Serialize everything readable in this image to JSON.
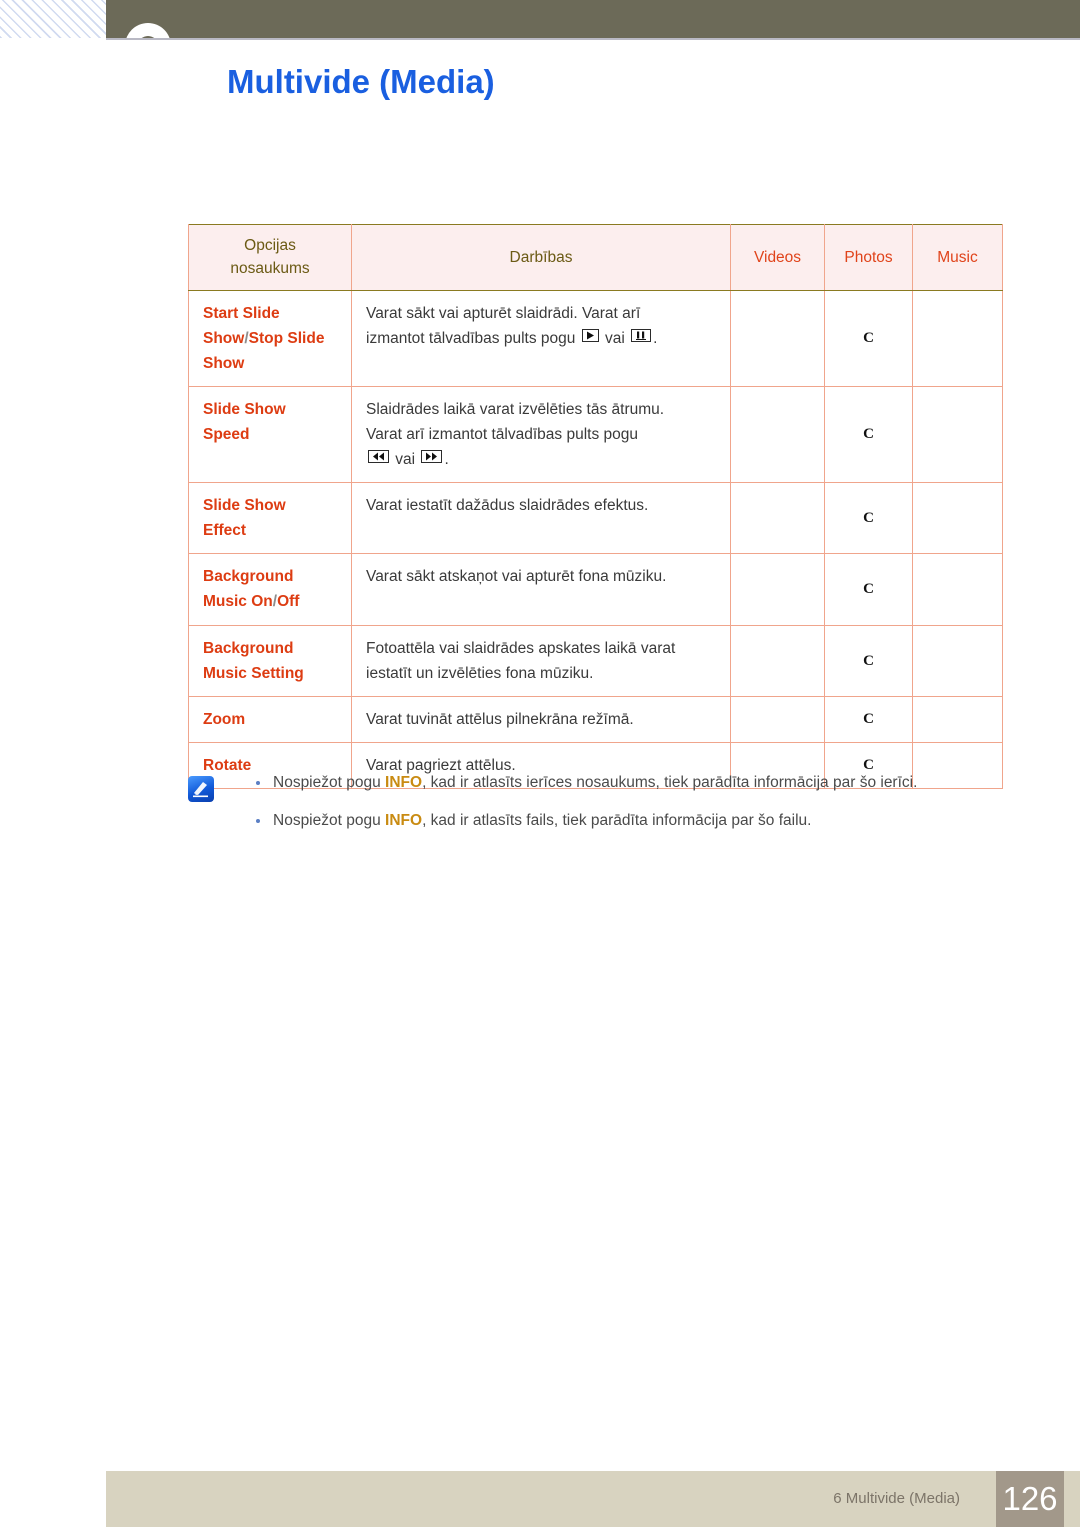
{
  "header": {
    "title": "Multivide (Media)",
    "chapter_badge": "chapter-circle"
  },
  "table": {
    "columns": [
      {
        "label": "Opcijas\nnosaukums",
        "line1": "Opcijas",
        "line2": "nosaukums",
        "style": "olive"
      },
      {
        "label": "Darbības",
        "style": "olive"
      },
      {
        "label": "Videos",
        "style": "red"
      },
      {
        "label": "Photos",
        "style": "red"
      },
      {
        "label": "Music",
        "style": "red"
      }
    ],
    "rows": [
      {
        "name_parts": [
          "Start Slide Show",
          "/",
          "Stop Slide Show"
        ],
        "name_plain": "Start Slide Show/Stop Slide Show",
        "desc_line1": "Varat sākt vai apturēt slaidrādi. Varat arī",
        "desc_line2_pre": "izmantot tālvadības pults pogu ",
        "desc_mid": " vai ",
        "desc_end": ".",
        "keys": [
          "play-icon",
          "pause-icon"
        ],
        "videos": "",
        "photos": "C",
        "music": ""
      },
      {
        "name_parts": [
          "Slide Show Speed"
        ],
        "name_plain": "Slide Show Speed",
        "desc_line1": "Slaidrādes laikā varat izvēlēties tās ātrumu.",
        "desc_line2_pre": "Varat arī izmantot tālvadības pults pogu",
        "desc_mid": " vai ",
        "desc_end": ".",
        "keys": [
          "rewind-icon",
          "fast-forward-icon"
        ],
        "videos": "",
        "photos": "C",
        "music": ""
      },
      {
        "name_parts": [
          "Slide Show Effect"
        ],
        "name_plain": "Slide Show Effect",
        "desc_line1": "Varat iestatīt dažādus slaidrādes efektus.",
        "videos": "",
        "photos": "C",
        "music": ""
      },
      {
        "name_parts": [
          "Background Music On",
          "/",
          "Off"
        ],
        "name_plain": "Background Music On/Off",
        "desc_line1": "Varat sākt atskaņot vai apturēt fona mūziku.",
        "videos": "",
        "photos": "C",
        "music": ""
      },
      {
        "name_parts": [
          "Background Music Setting"
        ],
        "name_plain": "Background Music Setting",
        "desc_line1": "Fotoattēla vai slaidrādes apskates laikā varat",
        "desc_line2_pre": "iestatīt un izvēlēties fona mūziku.",
        "videos": "",
        "photos": "C",
        "music": ""
      },
      {
        "name_parts": [
          "Zoom"
        ],
        "name_plain": "Zoom",
        "desc_line1": "Varat tuvināt attēlus pilnekrāna režīmā.",
        "videos": "",
        "photos": "C",
        "music": ""
      },
      {
        "name_parts": [
          "Rotate"
        ],
        "name_plain": "Rotate",
        "desc_line1": "Varat pagriezt attēlus.",
        "videos": "",
        "photos": "C",
        "music": ""
      }
    ]
  },
  "note": {
    "icon": "note-pencil-icon",
    "items": [
      {
        "pre": "Nospiežot pogu ",
        "key": "INFO",
        "post": ", kad ir atlasīts ierīces nosaukums, tiek parādīta informācija par šo ierīci."
      },
      {
        "pre": "Nospiežot pogu ",
        "key": "INFO",
        "post": ", kad ir atlasīts fails, tiek parādīta informācija par šo failu."
      }
    ]
  },
  "footer": {
    "chapter": "6 Multivide (Media)",
    "page": "126"
  },
  "colors": {
    "header_band": "#6c6a58",
    "title": "#1a5fe0",
    "table_outer_border": "#8a7a20",
    "table_inner_border": "#f0a58c",
    "header_fill": "#fceeee",
    "header_olive_text": "#6b5a14",
    "header_red_text": "#e0431a",
    "option_name": "#dd3c12",
    "info_key": "#c98b12",
    "footer_band": "#d8d3c0",
    "footer_page_block": "#a2988a"
  }
}
